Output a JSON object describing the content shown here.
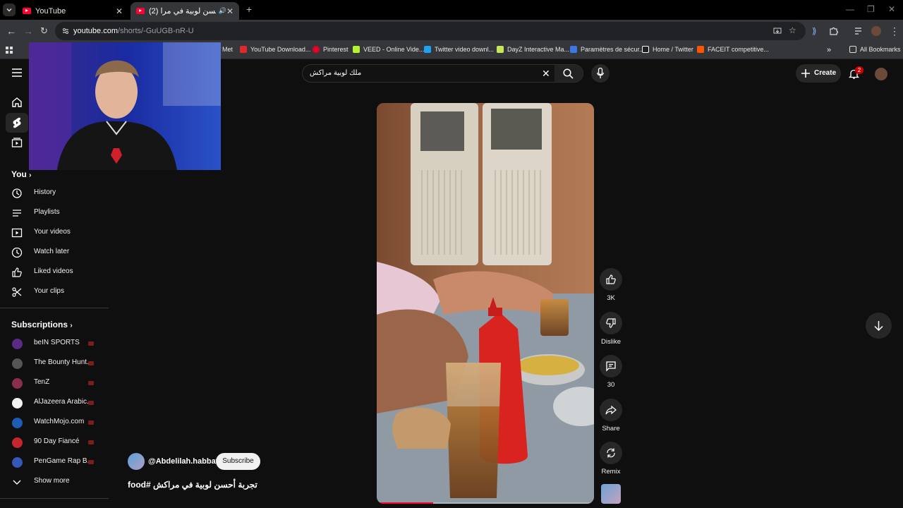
{
  "browser": {
    "tabs": [
      {
        "label": "YouTube"
      },
      {
        "label": "(2) تجربة أحسن لوبية في مرا..."
      }
    ],
    "url_host": "youtube.com",
    "url_path": "/shorts/-GuUGB-nR-U",
    "bookmarks": [
      {
        "label": "Met",
        "color": "#ffffff"
      },
      {
        "label": "YouTube Download...",
        "color": "#e0292b"
      },
      {
        "label": "Pinterest",
        "color": "#e60023"
      },
      {
        "label": "VEED - Online Vide...",
        "color": "#b6f22e"
      },
      {
        "label": "Twitter video downl...",
        "color": "#1da1f2"
      },
      {
        "label": "DayZ Interactive Ma...",
        "color": "#c8e65a"
      },
      {
        "label": "Paramètres de sécur...",
        "color": "#3b78e7"
      },
      {
        "label": "Home / Twitter",
        "color": "#ffffff"
      },
      {
        "label": "FACEIT competitive...",
        "color": "#ff5500"
      }
    ],
    "all_bookmarks": "All Bookmarks"
  },
  "sidebar": {
    "you_label": "You",
    "you_items": [
      {
        "label": "History",
        "icon": "history-icon"
      },
      {
        "label": "Playlists",
        "icon": "playlists-icon"
      },
      {
        "label": "Your videos",
        "icon": "your-videos-icon"
      },
      {
        "label": "Watch later",
        "icon": "clock-icon"
      },
      {
        "label": "Liked videos",
        "icon": "thumbs-up-icon"
      },
      {
        "label": "Your clips",
        "icon": "scissors-icon"
      }
    ],
    "subscriptions_label": "Subscriptions",
    "subscriptions": [
      {
        "label": "beIN SPORTS",
        "color": "#5b2a86"
      },
      {
        "label": "The Bounty Hunt...",
        "color": "#555555"
      },
      {
        "label": "TenZ",
        "color": "#8a2f4b"
      },
      {
        "label": "AlJazeera Arabic...",
        "color": "#f2f2f2"
      },
      {
        "label": "WatchMojo.com",
        "color": "#1b5fb4"
      },
      {
        "label": "90 Day Fiancé",
        "color": "#c4262e"
      },
      {
        "label": "PenGame Rap B...",
        "color": "#3557b7"
      }
    ],
    "show_more": "Show more"
  },
  "header": {
    "search_query": "ملك لوبية مراكش",
    "create_label": "Create",
    "notification_count": "2"
  },
  "short": {
    "progress": 0.26,
    "channel": "@Abdelilah.habbat",
    "subscribe_label": "Subscribe",
    "title": "تجربة أحسن لوبية في مراكش #food",
    "actions": {
      "likes": "3K",
      "dislike": "Dislike",
      "comments": "30",
      "share": "Share",
      "remix": "Remix"
    }
  }
}
